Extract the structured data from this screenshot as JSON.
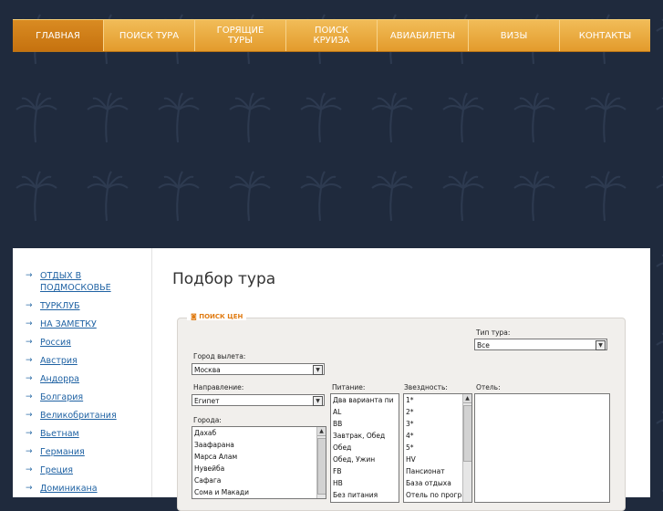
{
  "nav": {
    "items": [
      {
        "label": "ГЛАВНАЯ",
        "active": true
      },
      {
        "label": "ПОИСК ТУРА"
      },
      {
        "label": "ГОРЯЩИЕ\nТУРЫ"
      },
      {
        "label": "ПОИСК\nКРУИЗА"
      },
      {
        "label": "АВИАБИЛЕТЫ"
      },
      {
        "label": "ВИЗЫ"
      },
      {
        "label": "КОНТАКТЫ"
      }
    ]
  },
  "sidebar": {
    "items": [
      "ОТДЫХ В ПОДМОСКОВЬЕ",
      "ТУРКЛУБ",
      "НА ЗАМЕТКУ",
      "Россия",
      "Австрия",
      "Андорра",
      "Болгария",
      "Великобритания",
      "Вьетнам",
      "Германия",
      "Греция",
      "Доминикана"
    ]
  },
  "main": {
    "title": "Подбор тура",
    "search": {
      "legend": "ПОИСК ЦЕН",
      "tour_type_label": "Тип тура:",
      "tour_type_value": "Все",
      "departure_label": "Город вылета:",
      "departure_value": "Москва",
      "direction_label": "Направление:",
      "direction_value": "Египет",
      "cities_label": "Города:",
      "cities": [
        "Дахаб",
        "Заафарана",
        "Марса Алам",
        "Нувейба",
        "Сафага",
        "Сома и Макади"
      ],
      "meal_label": "Питание:",
      "meals": [
        "Два варианта пи",
        "AL",
        "BB",
        "Завтрак, Обед",
        "Обед",
        "Обед, Ужин",
        "FB",
        "HB",
        "Без питания"
      ],
      "stars_label": "Звездность:",
      "stars": [
        "1*",
        "2*",
        "3*",
        "4*",
        "5*",
        "HV",
        "Пансионат",
        "База отдыха",
        "Отель по програ"
      ],
      "hotel_label": "Отель:"
    }
  },
  "colors": {
    "background": "#1f2a3d",
    "nav_orange": "#e3a23a",
    "nav_active": "#c6720f",
    "link": "#1f62a3",
    "legend": "#e07b12"
  }
}
